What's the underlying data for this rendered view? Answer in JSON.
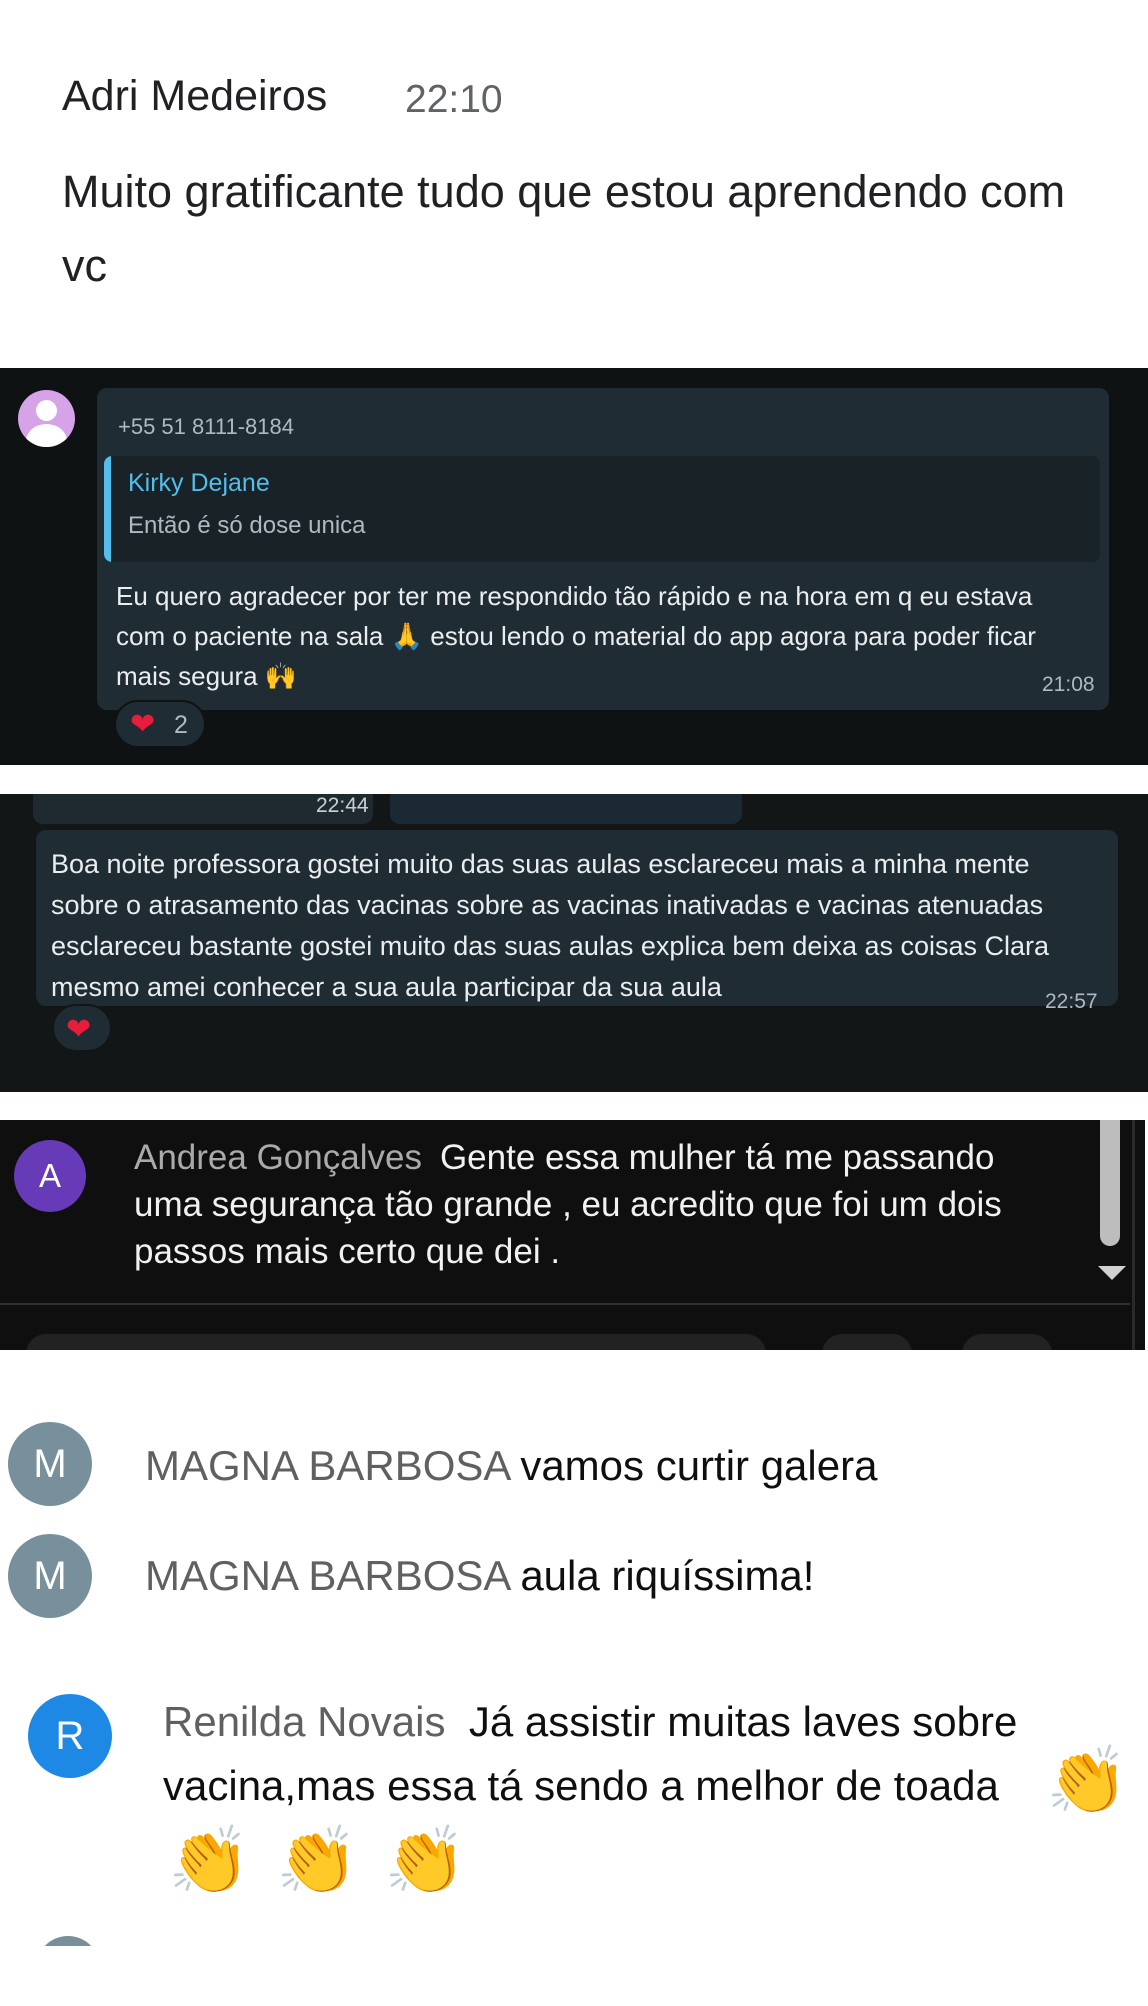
{
  "section1": {
    "author": "Adri Medeiros",
    "time": "22:10",
    "message": "Muito gratificante tudo que estou aprendendo com vc"
  },
  "section2": {
    "avatar_icon": "user-avatar-icon",
    "sender_phone": "+55 51 8111-8184",
    "quoted_author": "Kirky Dejane",
    "quoted_message": "Então é só dose unica",
    "message_part1": "Eu quero agradecer por ter me respondido tão rápido e na hora em q eu estava com o paciente na sala",
    "emoji_pray": "🙏",
    "message_part2": "estou lendo o material do app agora para poder ficar mais segura",
    "emoji_hands": "🙌",
    "time": "21:08",
    "reaction_icon": "❤",
    "reaction_count": "2"
  },
  "section3": {
    "previous_time": "22:44",
    "message": "Boa noite professora gostei muito das suas aulas esclareceu mais a minha mente sobre o atrasamento das vacinas sobre as vacinas inativadas e vacinas atenuadas esclareceu bastante gostei muito das suas aulas explica bem deixa as coisas Clara mesmo amei conhecer a sua aula participar da sua aula",
    "time": "22:57",
    "reaction_icon": "❤"
  },
  "section4": {
    "avatar_letter": "A",
    "author": "Andrea Gonçalves",
    "message": "Gente essa mulher tá me passando uma segurança tão grande , eu acredito que foi um dois passos mais certo que dei ."
  },
  "section5": {
    "comments": [
      {
        "avatar_letter": "M",
        "author": "MAGNA BARBOSA",
        "message": "vamos curtir galera"
      },
      {
        "avatar_letter": "M",
        "author": "MAGNA BARBOSA",
        "message": "aula riquíssima!"
      },
      {
        "avatar_letter": "R",
        "author": "Renilda Novais",
        "message": "Já assistir muitas laves sobre vacina,mas essa tá sendo a melhor de toada",
        "emoji": "👏"
      }
    ]
  },
  "colors": {
    "whatsapp_bg": "#0f1213",
    "whatsapp_bubble": "#202c33",
    "whatsapp_quote_accent": "#53bdeb",
    "youtube_dark_bg": "#0f0f0f",
    "avatar_purple": "#673ab7",
    "avatar_grey": "#78909c",
    "avatar_blue": "#1e88e5"
  }
}
